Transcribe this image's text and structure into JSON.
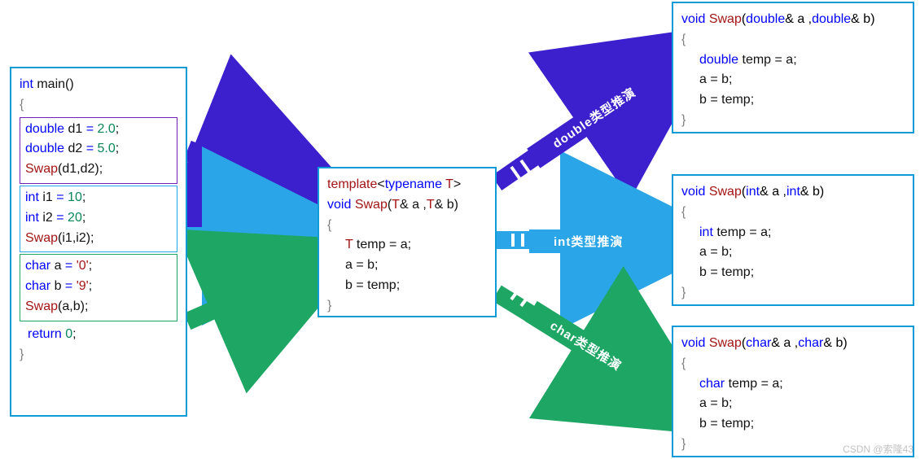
{
  "main_box": {
    "head": [
      "int",
      " main",
      "()"
    ],
    "brace_open": "{",
    "block_double": {
      "lines": [
        [
          "double",
          " d1 ",
          "=",
          " 2.0",
          ";"
        ],
        [
          "double",
          " d2 ",
          "=",
          " 5.0",
          ";"
        ],
        [
          "",
          "Swap",
          "(d1,d2)",
          ";"
        ]
      ],
      "border_color": "#6f1fb5"
    },
    "block_int": {
      "lines": [
        [
          "int",
          " i1 ",
          "=",
          " 10",
          ";"
        ],
        [
          "int",
          " i2 ",
          "=",
          " 20",
          ";"
        ],
        [
          "",
          "Swap",
          "(i1,i2)",
          ";"
        ]
      ],
      "border_color": "#2aa5e8"
    },
    "block_char": {
      "lines": [
        [
          "char",
          " a ",
          "=",
          " '0'",
          ";"
        ],
        [
          "char",
          " b ",
          "=",
          " '9'",
          ";"
        ],
        [
          "",
          "Swap",
          "(a,b)",
          ";"
        ]
      ],
      "border_color": "#1ea664"
    },
    "ret": [
      "return",
      " 0",
      ";"
    ],
    "brace_close": "}"
  },
  "template_box": {
    "lines": [
      "template<typename T>",
      "void Swap(T& a ,T& b)",
      "{",
      "    T temp = a;",
      "    a = b;",
      "    b = temp;",
      "}"
    ],
    "colored": {
      "template_kw": "template",
      "typename_kw": "typename",
      "T": "T",
      "void": "void",
      "fn": "Swap"
    }
  },
  "out_double": {
    "sig_tokens": [
      "void",
      " ",
      "Swap",
      "(",
      "double",
      "& a ,",
      "double",
      "& b)"
    ],
    "body": [
      "{",
      "    double temp = a;",
      "    a = b;",
      "    b = temp;",
      "}"
    ],
    "type": "double"
  },
  "out_int": {
    "sig_tokens": [
      "void",
      " ",
      "Swap",
      "(",
      "int",
      "& a ,",
      "int",
      "& b)"
    ],
    "body": [
      "{",
      "    int temp = a;",
      "    a = b;",
      "    b = temp;",
      "}"
    ],
    "type": "int"
  },
  "out_char": {
    "sig_tokens": [
      "void",
      " ",
      "Swap",
      "(",
      "char",
      "& a ,",
      "char",
      "& b)"
    ],
    "body": [
      "{",
      "    char temp = a;",
      "    a = b;",
      "    b = temp;",
      "}"
    ],
    "type": "char"
  },
  "labels": {
    "double": "double类型推演",
    "int": "int类型推演",
    "char": "char类型推演"
  },
  "watermark": "CSDN @索隆43",
  "chart_data": {
    "type": "diagram",
    "description": "C++ function template instantiation. The main() function calls Swap with three different type pairs; the generic template is shown in the center, and three arrows labeled by the deduced type point to the corresponding concrete Swap function instantiations on the right.",
    "inputs": [
      "double",
      "int",
      "char"
    ],
    "template": "template<typename T> void Swap(T& a, T& b) { T temp = a; a = b; b = temp; }",
    "outputs": [
      {
        "type": "double",
        "function": "void Swap(double& a, double& b)"
      },
      {
        "type": "int",
        "function": "void Swap(int& a, int& b)"
      },
      {
        "type": "char",
        "function": "void Swap(char& a, char& b)"
      }
    ]
  }
}
